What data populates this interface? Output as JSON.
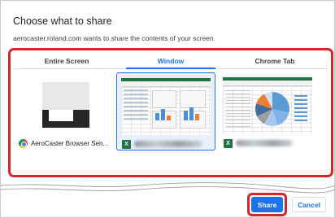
{
  "dialog": {
    "title": "Choose what to share",
    "subtitle": "aerocaster.roland.com wants to share the contents of your screen."
  },
  "tabs": [
    {
      "label": "Entire Screen",
      "selected": false
    },
    {
      "label": "Window",
      "selected": true
    },
    {
      "label": "Chrome Tab",
      "selected": false
    }
  ],
  "sources": [
    {
      "label": "AeroCaster Browser Sen...",
      "icon": "chrome-icon",
      "selected": false
    },
    {
      "label": "",
      "icon": "excel-icon",
      "selected": true,
      "label_blurred": true
    },
    {
      "label": "",
      "icon": "excel-icon",
      "selected": false,
      "label_blurred": true
    }
  ],
  "icons": {
    "excel_letter": "X"
  },
  "buttons": {
    "share": "Share",
    "cancel": "Cancel"
  },
  "colors": {
    "accent": "#1a73e8",
    "highlight": "#d8232a",
    "excel": "#217346"
  }
}
